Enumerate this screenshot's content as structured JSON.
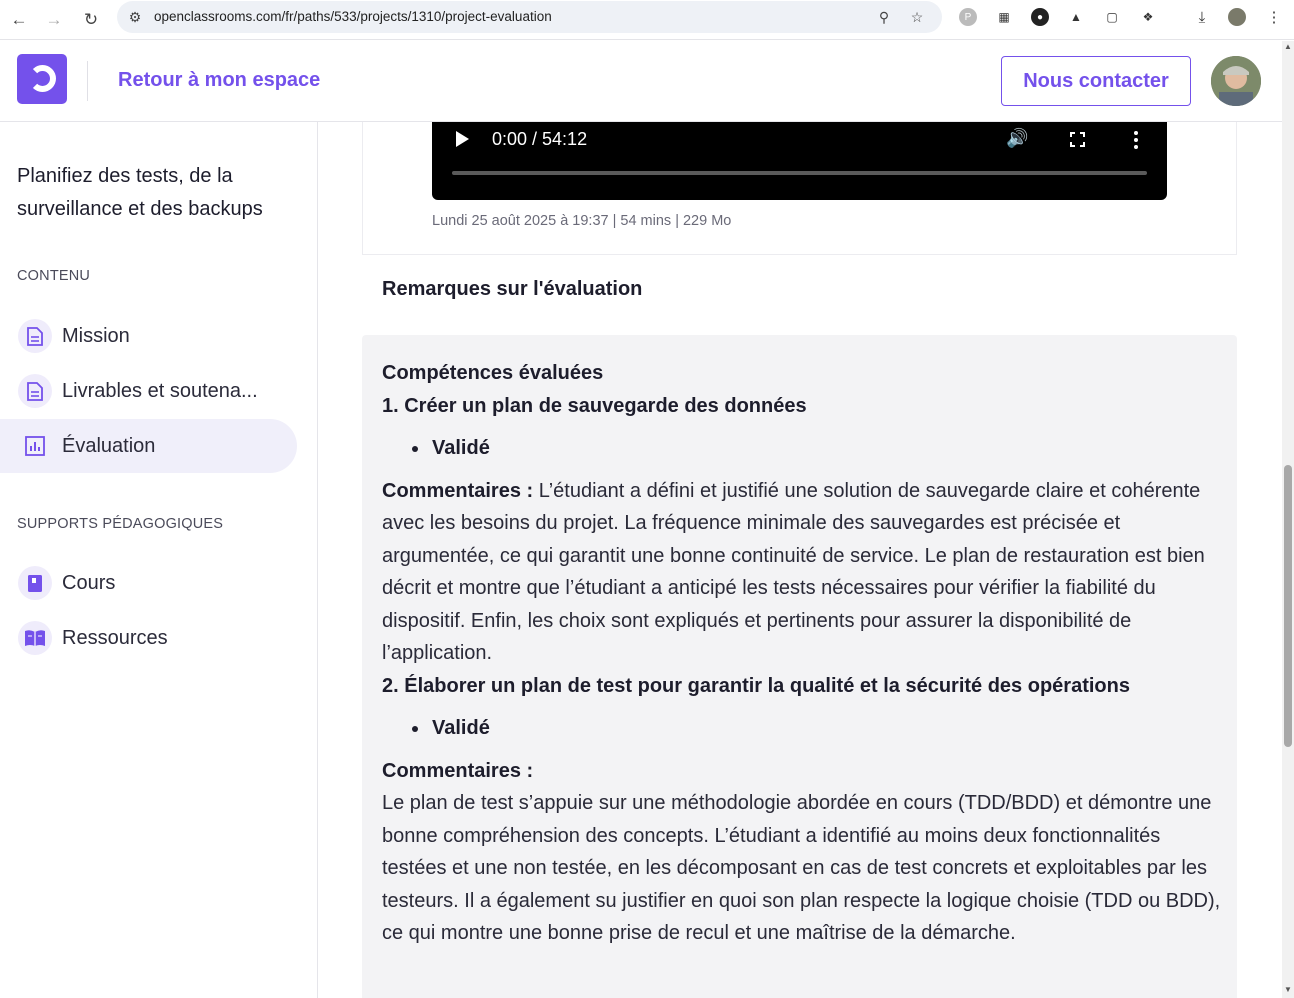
{
  "browser": {
    "url": "openclassrooms.com/fr/paths/533/projects/1310/project-evaluation",
    "back_icon": "arrow-left-icon",
    "forward_icon": "arrow-right-icon",
    "reload_icon": "reload-icon"
  },
  "header": {
    "back_label": "Retour à mon espace",
    "contact_label": "Nous contacter",
    "brand_color": "#7451eb"
  },
  "sidebar": {
    "title": "Planifiez des tests, de la surveillance et des backups",
    "content_section": "CONTENU",
    "content_items": [
      {
        "label": "Mission",
        "icon": "document-icon"
      },
      {
        "label": "Livrables et soutena...",
        "icon": "document-icon"
      },
      {
        "label": "Évaluation",
        "icon": "chart-icon"
      }
    ],
    "supports_section": "SUPPORTS PÉDAGOGIQUES",
    "support_items": [
      {
        "label": "Cours",
        "icon": "book-icon"
      },
      {
        "label": "Ressources",
        "icon": "open-book-icon"
      }
    ]
  },
  "video": {
    "time": "0:00 / 54:12",
    "meta": "Lundi 25 août 2025 à 19:37 | 54 mins | 229 Mo"
  },
  "remarks": {
    "title": "Remarques sur l'évaluation",
    "heading": "Compétences évaluées",
    "skill1_title": "1. Créer un plan de sauvegarde des données",
    "skill1_status": "Validé",
    "comment_label": "Commentaires :",
    "skill1_comment": "L’étudiant a défini et justifié une solution de sauvegarde claire et cohérente avec les besoins du projet. La fréquence minimale des sauvegardes est précisée et argumentée, ce qui garantit une bonne continuité de service. Le plan de restauration est bien décrit et montre que l’étudiant a anticipé les tests nécessaires pour vérifier la fiabilité du dispositif. Enfin, les choix sont expliqués et pertinents pour assurer la disponibilité de l’application.",
    "skill2_title": "2. Élaborer un plan de test pour garantir la qualité et la sécurité des opérations",
    "skill2_status": "Validé",
    "skill2_comment": "Le plan de test s’appuie sur une méthodologie abordée en cours (TDD/BDD) et démontre une bonne compréhension des concepts. L’étudiant a identifié au moins deux fonctionnalités testées et une non testée, en les décomposant en cas de test concrets et exploitables par les testeurs. Il a également su justifier en quoi son plan respecte la logique choisie (TDD ou BDD), ce qui montre une bonne prise de recul et une maîtrise de la démarche."
  }
}
